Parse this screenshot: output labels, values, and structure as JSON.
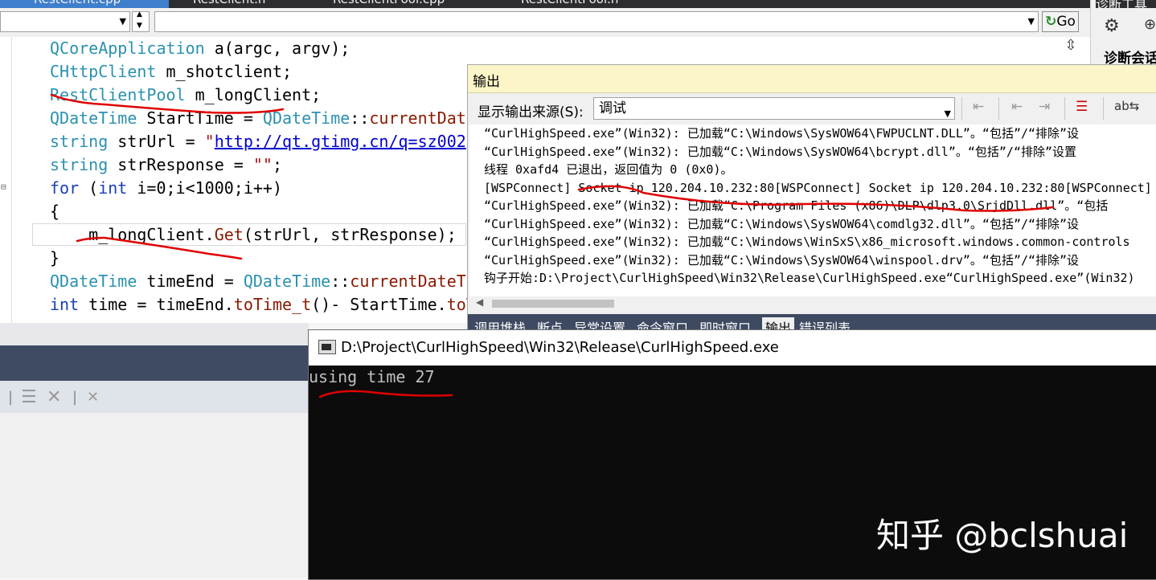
{
  "tabs": [
    "RestClient.cpp",
    "RestClient.h",
    "RestClientPool.cpp",
    "RestClientPool.h"
  ],
  "right_panel": {
    "title": "诊断工具",
    "session_label": "诊断会话"
  },
  "navbar": {
    "go_label": "Go"
  },
  "code": {
    "lines": [
      [
        {
          "t": "QCoreApplication",
          "c": "ty"
        },
        {
          "t": " a(argc, argv);",
          "c": "plain"
        }
      ],
      [
        {
          "t": "CHttpClient",
          "c": "ty"
        },
        {
          "t": " m_shotclient;",
          "c": "plain"
        }
      ],
      [
        {
          "t": "RestClientPool",
          "c": "ty"
        },
        {
          "t": " m_longClient;",
          "c": "plain"
        }
      ],
      [
        {
          "t": "QDateTime",
          "c": "ty"
        },
        {
          "t": " StartTime = ",
          "c": "plain"
        },
        {
          "t": "QDateTime",
          "c": "ty"
        },
        {
          "t": "::",
          "c": "plain"
        },
        {
          "t": "currentDate",
          "c": "fn"
        }
      ],
      [
        {
          "t": "string",
          "c": "ty"
        },
        {
          "t": " strUrl = ",
          "c": "plain"
        },
        {
          "t": "\"",
          "c": "str"
        },
        {
          "t": "http://qt.gtimg.cn/q=sz002",
          "c": "link"
        }
      ],
      [
        {
          "t": "string",
          "c": "ty"
        },
        {
          "t": " strResponse = ",
          "c": "plain"
        },
        {
          "t": "\"\"",
          "c": "str"
        },
        {
          "t": ";",
          "c": "plain"
        }
      ],
      [
        {
          "t": "for",
          "c": "kw"
        },
        {
          "t": " (",
          "c": "plain"
        },
        {
          "t": "int",
          "c": "kw"
        },
        {
          "t": " i=0;i<1000;i++)",
          "c": "plain"
        }
      ],
      [
        {
          "t": "{",
          "c": "plain"
        }
      ],
      [
        {
          "t": "    m_longClient.",
          "c": "plain"
        },
        {
          "t": "Get",
          "c": "fn"
        },
        {
          "t": "(strUrl, strResponse);",
          "c": "plain"
        }
      ],
      [
        {
          "t": "}",
          "c": "plain"
        }
      ],
      [
        {
          "t": "QDateTime",
          "c": "ty"
        },
        {
          "t": " timeEnd = ",
          "c": "plain"
        },
        {
          "t": "QDateTime",
          "c": "ty"
        },
        {
          "t": "::",
          "c": "plain"
        },
        {
          "t": "currentDateTi",
          "c": "fn"
        }
      ],
      [
        {
          "t": "int",
          "c": "kw"
        },
        {
          "t": " time = timeEnd.",
          "c": "plain"
        },
        {
          "t": "toTime_t",
          "c": "fn"
        },
        {
          "t": "()- StartTime.",
          "c": "plain"
        },
        {
          "t": "toT",
          "c": "fn"
        }
      ]
    ]
  },
  "output": {
    "title": "输出",
    "source_label": "显示输出来源(S):",
    "source_value": "调试",
    "lines": [
      "“CurlHighSpeed.exe”(Win32): 已加载“C:\\Windows\\SysWOW64\\FWPUCLNT.DLL”。“包括”/“排除”设",
      "“CurlHighSpeed.exe”(Win32): 已加载“C:\\Windows\\SysWOW64\\bcrypt.dll”。“包括”/“排除”设置",
      "线程 0xafd4 已退出，返回值为 0 (0x0)。",
      "[WSPConnect] Socket ip 120.204.10.232:80[WSPConnect] Socket ip 120.204.10.232:80[WSPConnect]",
      "“CurlHighSpeed.exe”(Win32): 已加载“C:\\Program Files (x86)\\DLP\\dlp3.0\\SrjdDll.dll”。“包括",
      "“CurlHighSpeed.exe”(Win32): 已加载“C:\\Windows\\SysWOW64\\comdlg32.dll”。“包括”/“排除”设",
      "“CurlHighSpeed.exe”(Win32): 已加载“C:\\Windows\\WinSxS\\x86_microsoft.windows.common-controls",
      "“CurlHighSpeed.exe”(Win32): 已加载“C:\\Windows\\SysWOW64\\winspool.drv”。“包括”/“排除”设",
      "钩子开始:D:\\Project\\CurlHighSpeed\\Win32\\Release\\CurlHighSpeed.exe“CurlHighSpeed.exe”(Win32)"
    ],
    "tabs": [
      "调用堆栈",
      "断点",
      "异常设置",
      "命令窗口",
      "即时窗口",
      "输出",
      "错误列表"
    ],
    "active_tab": "输出"
  },
  "console": {
    "title": "D:\\Project\\CurlHighSpeed\\Win32\\Release\\CurlHighSpeed.exe",
    "output": "using time 27"
  },
  "watermark": "知乎 @bclshuai",
  "colors": {
    "annotation": "#e00000",
    "output_title_bg": "#fbf5c8",
    "console_bg": "#0c0c0c"
  }
}
